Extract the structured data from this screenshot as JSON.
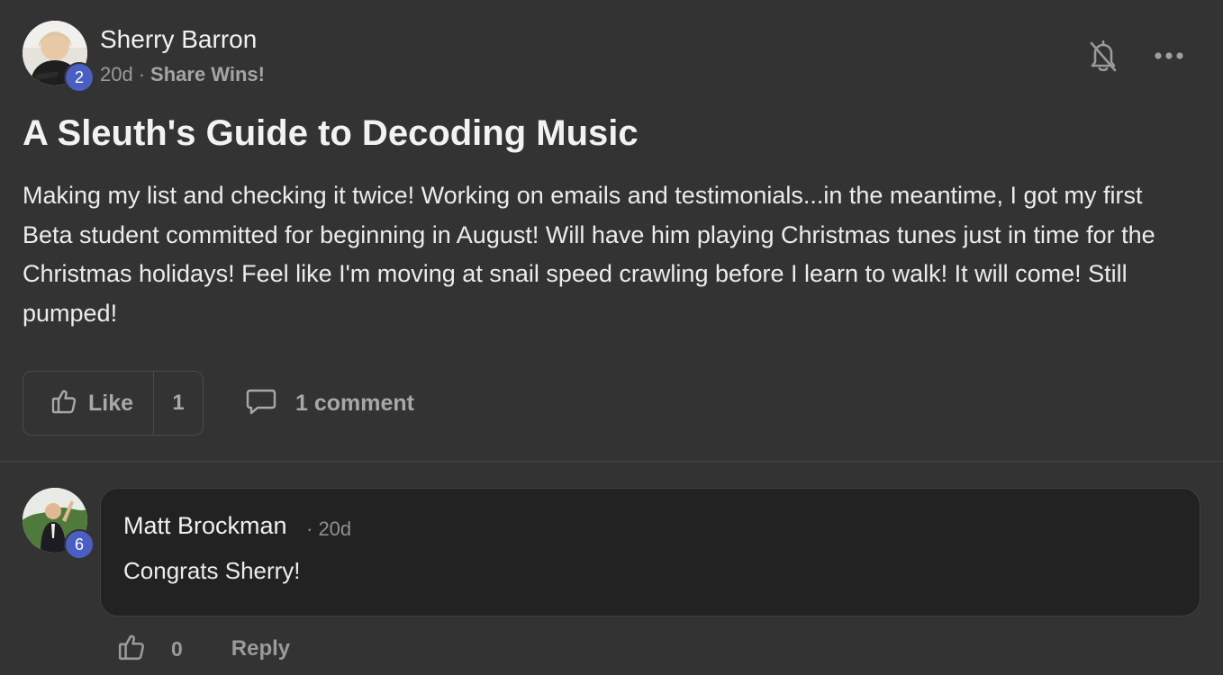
{
  "post": {
    "author": {
      "name": "Sherry Barron",
      "level": "2"
    },
    "time_ago": "20d",
    "separator": "·",
    "category": "Share Wins!",
    "title": "A Sleuth's Guide to Decoding Music",
    "body": "Making my list and checking it twice! Working on emails and testimonials...in the meantime, I got my first Beta student committed for beginning in August! Will have him playing Christmas tunes just in time for the Christmas holidays! Feel like I'm moving at snail speed crawling before I learn to walk! It will come! Still pumped!",
    "like_label": "Like",
    "like_count": "1",
    "comment_label": "1 comment",
    "icons": {
      "notify": "bell-off-icon",
      "menu": "more-icon",
      "like": "thumbs-up-icon",
      "comment": "chat-bubble-icon"
    }
  },
  "comment": {
    "author": {
      "name": "Matt Brockman",
      "level": "6"
    },
    "time_ago": "· 20d",
    "text": "Congrats Sherry!",
    "like_count": "0",
    "reply_label": "Reply"
  },
  "colors": {
    "background": "#333333",
    "comment_bubble": "#222222",
    "level_badge": "#4a5fc1"
  }
}
